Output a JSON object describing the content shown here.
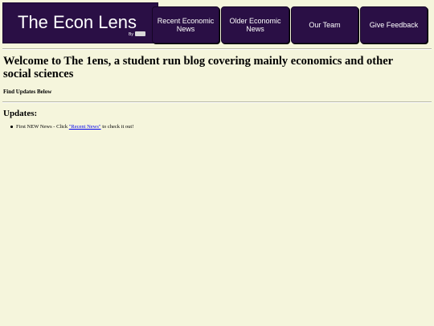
{
  "logo": {
    "title": "The Econ Lens",
    "by": "By"
  },
  "nav": {
    "items": [
      {
        "label": "Recent Economic News"
      },
      {
        "label": "Older Economic News"
      },
      {
        "label": "Our Team"
      },
      {
        "label": "Give Feedback"
      }
    ]
  },
  "main": {
    "welcome": "Welcome to The 1ens, a student run blog covering mainly economics and other social sciences",
    "find_updates": "Find Updates Below",
    "updates_heading": "Updates:",
    "updates": [
      {
        "prefix": "First NEW News - Click ",
        "link": "\"Recent News\"",
        "suffix": " to check it out!"
      }
    ]
  },
  "colors": {
    "background": "#f5f5dc",
    "nav_background": "#2a0f45",
    "link": "#0000ee"
  }
}
